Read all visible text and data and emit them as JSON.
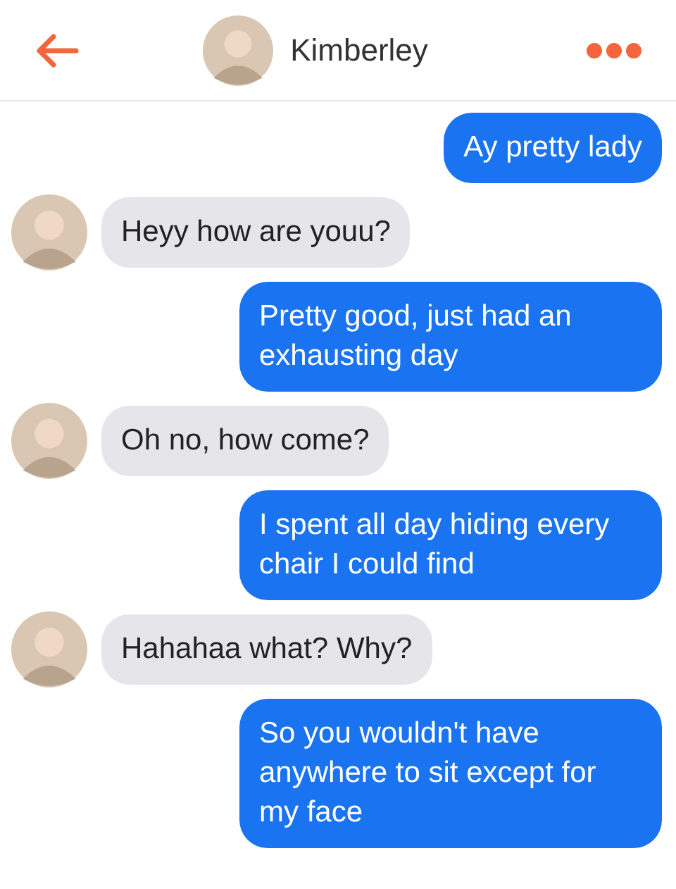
{
  "header": {
    "name": "Kimberley"
  },
  "messages": [
    {
      "kind": "sent",
      "text": "Ay pretty lady"
    },
    {
      "kind": "received",
      "text": "Heyy how are youu?"
    },
    {
      "kind": "sent",
      "text": "Pretty good, just had an exhausting day"
    },
    {
      "kind": "received",
      "text": "Oh no, how come?"
    },
    {
      "kind": "sent",
      "text": "I spent all day hiding every chair I could find"
    },
    {
      "kind": "received",
      "text": "Hahahaa what? Why?"
    },
    {
      "kind": "sent",
      "text": "So you wouldn't have anywhere to sit except for my face"
    }
  ]
}
